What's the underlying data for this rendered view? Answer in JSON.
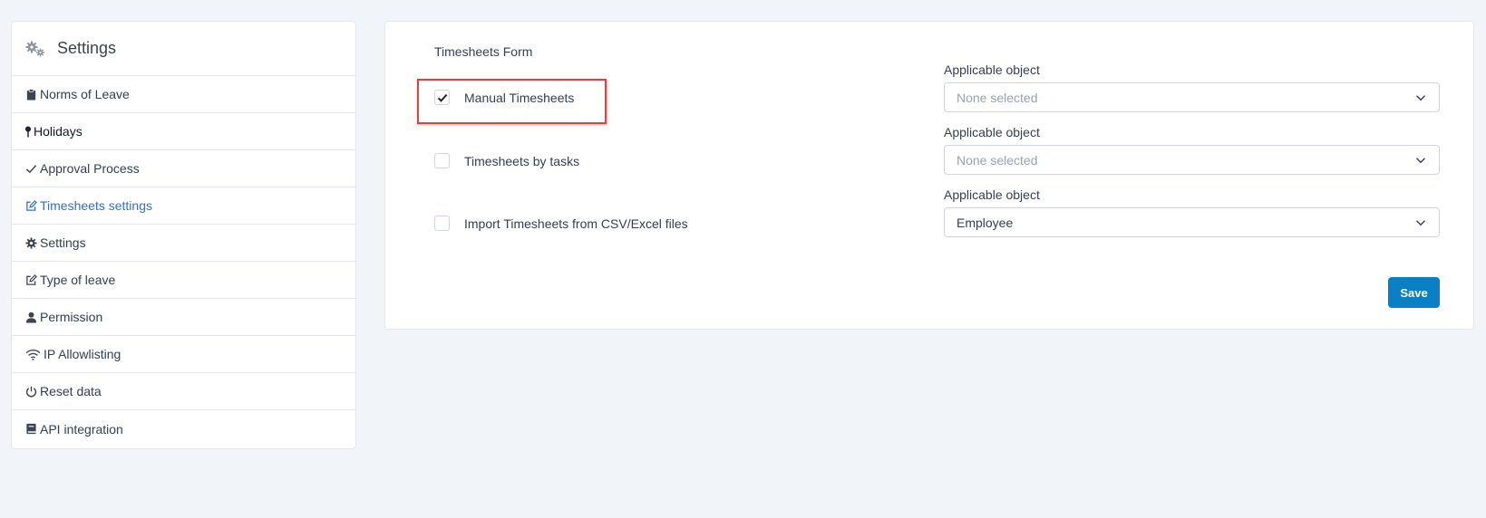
{
  "sidebar": {
    "title": "Settings",
    "items": [
      {
        "label": "Norms of Leave",
        "icon": "clipboard-icon"
      },
      {
        "label": "Holidays",
        "icon": "map-pin-icon"
      },
      {
        "label": "Approval Process",
        "icon": "check-icon"
      },
      {
        "label": "Timesheets settings",
        "icon": "edit-icon",
        "active": true
      },
      {
        "label": "Settings",
        "icon": "gear-icon"
      },
      {
        "label": "Type of leave",
        "icon": "edit-icon"
      },
      {
        "label": "Permission",
        "icon": "user-icon"
      },
      {
        "label": "IP Allowlisting",
        "icon": "wifi-icon"
      },
      {
        "label": "Reset data",
        "icon": "power-icon"
      },
      {
        "label": "API integration",
        "icon": "book-icon"
      }
    ]
  },
  "form": {
    "title": "Timesheets Form",
    "rows": [
      {
        "label": "Manual Timesheets",
        "checked": true,
        "object_label": "Applicable object",
        "select_value": "None selected",
        "placeholder": true
      },
      {
        "label": "Timesheets by tasks",
        "checked": false,
        "object_label": "Applicable object",
        "select_value": "None selected",
        "placeholder": true
      },
      {
        "label": "Import Timesheets from CSV/Excel files",
        "checked": false,
        "object_label": "Applicable object",
        "select_value": "Employee",
        "placeholder": false
      }
    ],
    "save_label": "Save"
  },
  "colors": {
    "accent": "#0a7fc4",
    "active_link": "#2f6fd6",
    "highlight": "#e5413b"
  }
}
